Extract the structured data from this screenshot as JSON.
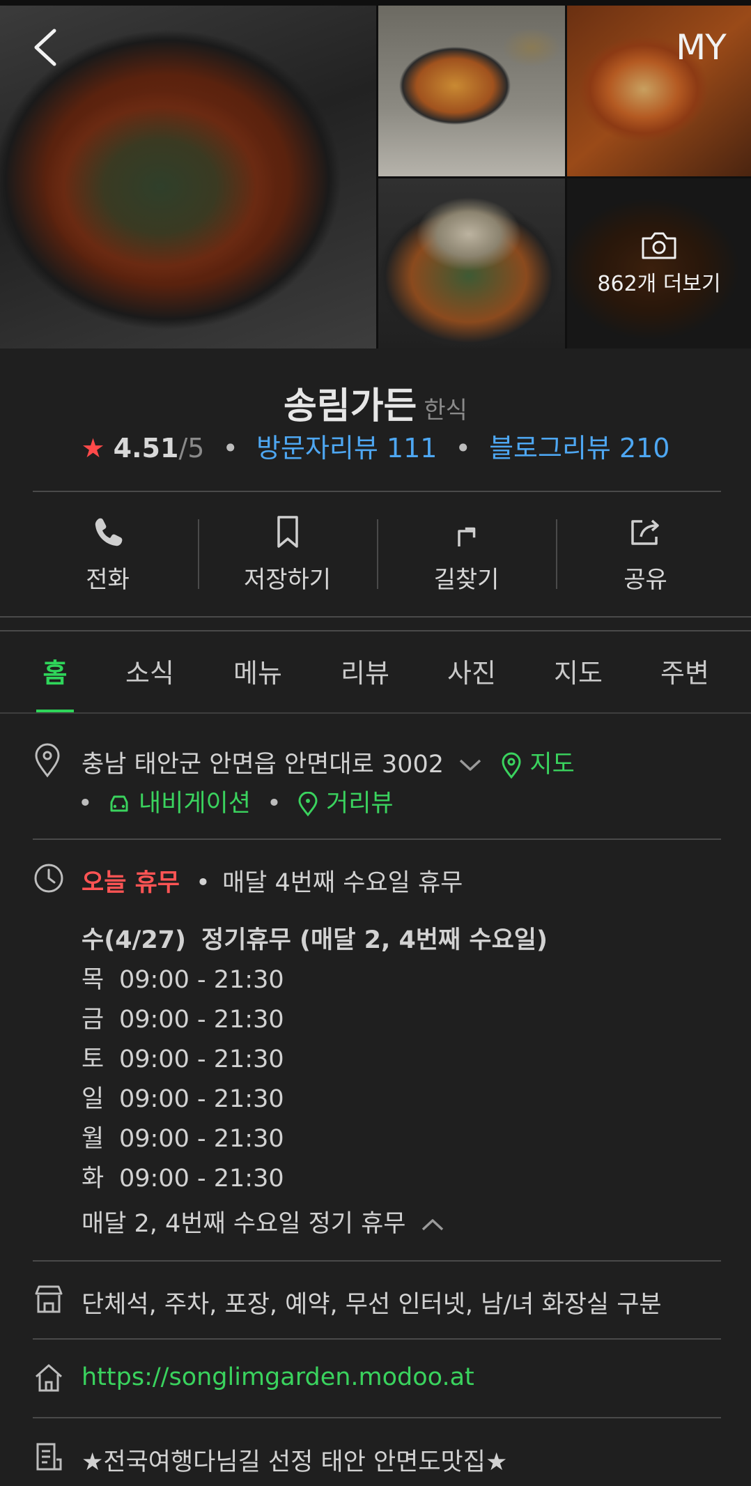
{
  "gallery": {
    "more_label": "862개 더보기",
    "my_label": "MY",
    "photo_count": 862
  },
  "place": {
    "name": "송림가든",
    "category": "한식",
    "star": "★",
    "rating": "4.51",
    "rating_max": "/5",
    "visitor_review_label": "방문자리뷰 111",
    "blog_review_label": "블로그리뷰 210"
  },
  "actions": {
    "call": "전화",
    "save": "저장하기",
    "directions": "길찾기",
    "share": "공유"
  },
  "tabs": [
    "홈",
    "소식",
    "메뉴",
    "리뷰",
    "사진",
    "지도",
    "주변"
  ],
  "address": {
    "text": "충남 태안군 안면읍 안면대로 3002",
    "map_label": "지도",
    "navigation_label": "내비게이션",
    "streetview_label": "거리뷰"
  },
  "hours": {
    "today_status": "오늘 휴무",
    "today_note": "매달 4번째 수요일 휴무",
    "rows": [
      {
        "day": "수(4/27)",
        "value": "정기휴무 (매달 2, 4번째 수요일)"
      },
      {
        "day": "목",
        "value": "09:00 - 21:30"
      },
      {
        "day": "금",
        "value": "09:00 - 21:30"
      },
      {
        "day": "토",
        "value": "09:00 - 21:30"
      },
      {
        "day": "일",
        "value": "09:00 - 21:30"
      },
      {
        "day": "월",
        "value": "09:00 - 21:30"
      },
      {
        "day": "화",
        "value": "09:00 - 21:30"
      }
    ],
    "footer": "매달 2, 4번째 수요일 정기 휴무"
  },
  "amenities": "단체석, 주차, 포장, 예약, 무선 인터넷, 남/녀 화장실 구분",
  "website": "https://songlimgarden.modoo.at",
  "description": "★전국여행다님길 선정 태안 안면도맛집★",
  "colors": {
    "background": "#1f1f1f",
    "accent_green": "#2fd55a",
    "link_blue": "#4ea7f2",
    "closed_red": "#ff5454",
    "star_red": "#ff4a4a"
  }
}
